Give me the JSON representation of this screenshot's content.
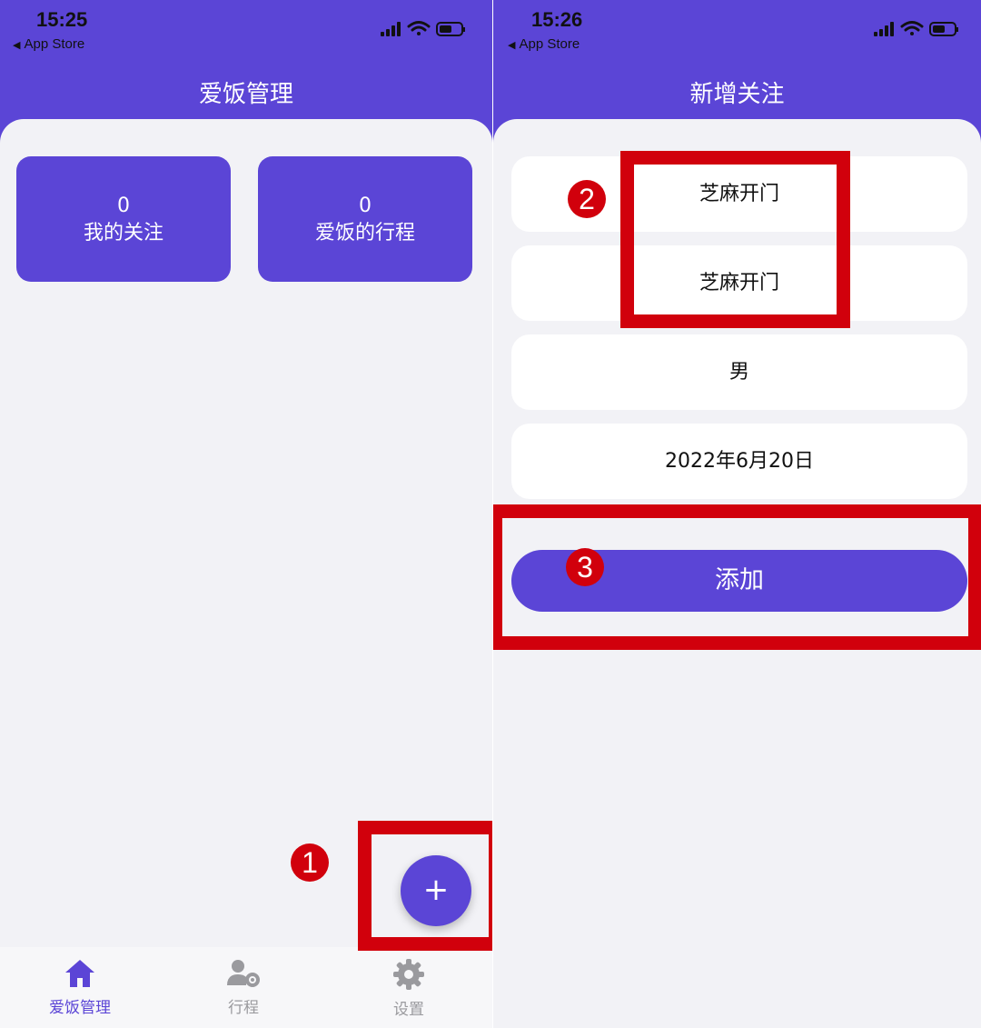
{
  "left": {
    "status": {
      "time": "15:25",
      "back_label": "App Store"
    },
    "nav_title": "爱饭管理",
    "cards": [
      {
        "count": "0",
        "label": "我的关注"
      },
      {
        "count": "0",
        "label": "爱饭的行程"
      }
    ],
    "fab_label": "+",
    "tabs": [
      {
        "label": "爱饭管理",
        "icon": "home-icon",
        "active": true
      },
      {
        "label": "行程",
        "icon": "user-gear-icon",
        "active": false
      },
      {
        "label": "设置",
        "icon": "gear-icon",
        "active": false
      }
    ]
  },
  "right": {
    "status": {
      "time": "15:26",
      "back_label": "App Store"
    },
    "nav_title": "新增关注",
    "fields": {
      "name": "芝麻开门",
      "alias": "芝麻开门",
      "gender": "男",
      "date": "2022年6月20日"
    },
    "add_button": "添加"
  },
  "annotations": [
    "1",
    "2",
    "3"
  ],
  "colors": {
    "accent": "#5b45d6",
    "background": "#f2f2f6",
    "highlight": "#d1000c",
    "tab_inactive": "#9a9a9e"
  }
}
